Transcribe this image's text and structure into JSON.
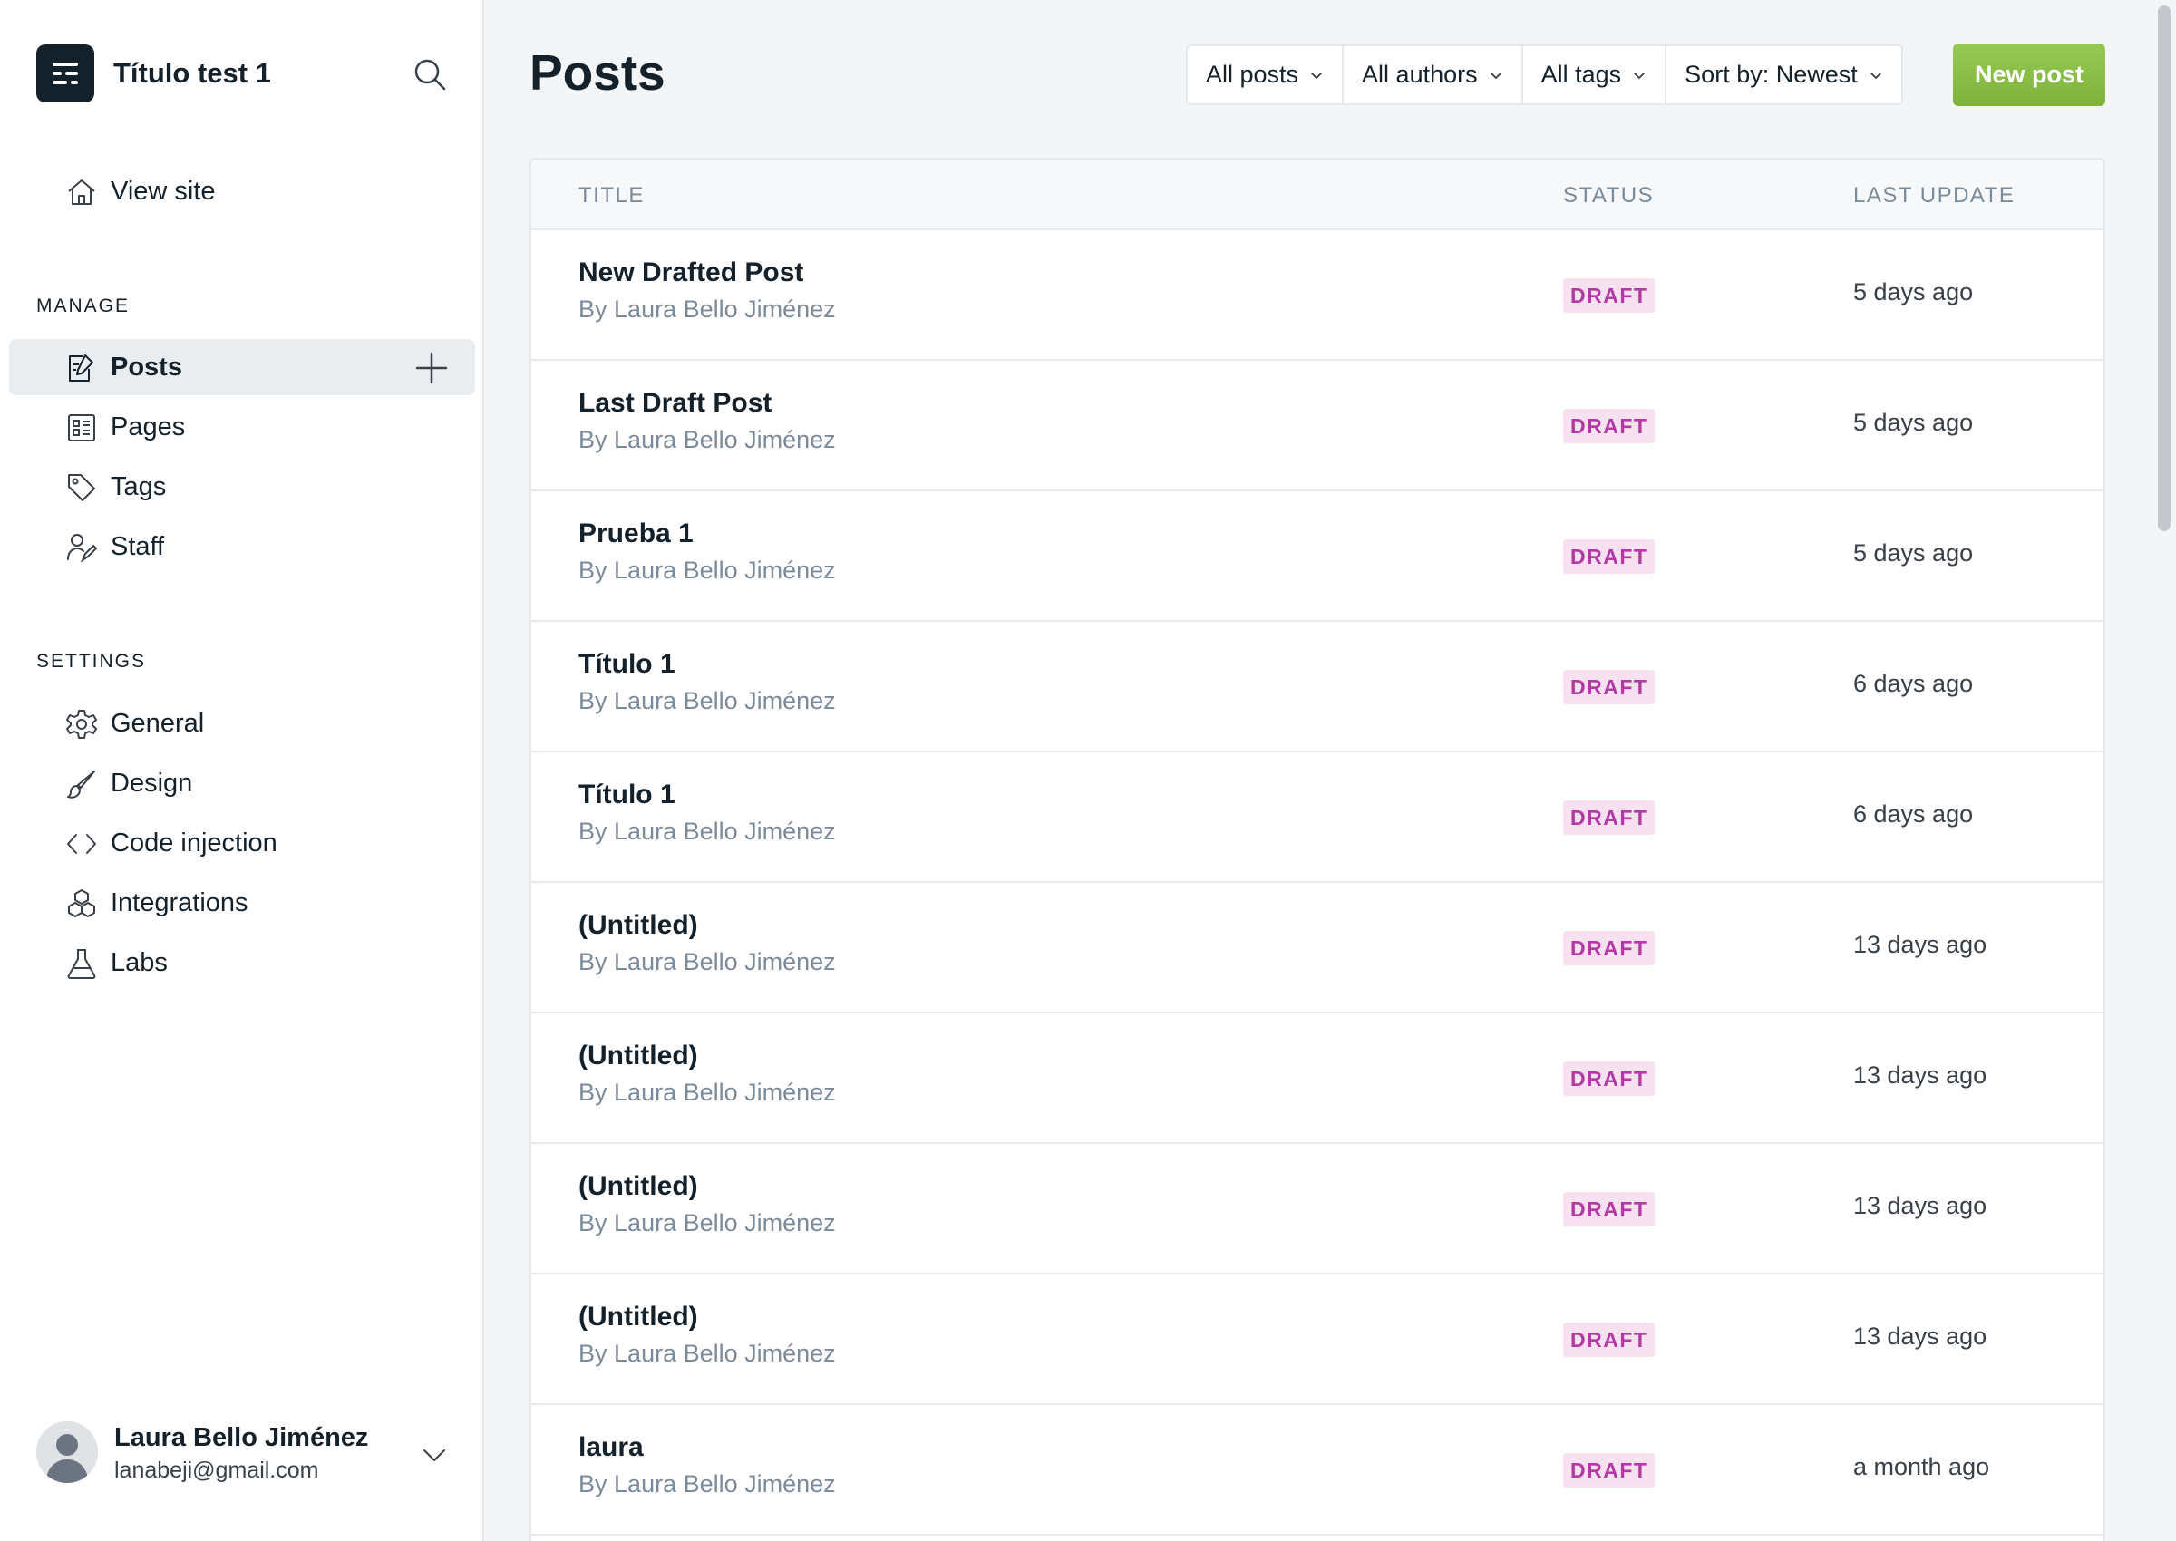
{
  "sidebar": {
    "site_title": "Título test 1",
    "view_site": "View site",
    "manage_label": "MANAGE",
    "manage_items": [
      {
        "label": "Posts",
        "icon": "posts-icon",
        "active": true
      },
      {
        "label": "Pages",
        "icon": "pages-icon"
      },
      {
        "label": "Tags",
        "icon": "tag-icon"
      },
      {
        "label": "Staff",
        "icon": "staff-icon"
      }
    ],
    "settings_label": "SETTINGS",
    "settings_items": [
      {
        "label": "General",
        "icon": "gear-icon"
      },
      {
        "label": "Design",
        "icon": "brush-icon"
      },
      {
        "label": "Code injection",
        "icon": "code-icon"
      },
      {
        "label": "Integrations",
        "icon": "integrations-icon"
      },
      {
        "label": "Labs",
        "icon": "flask-icon"
      }
    ],
    "user": {
      "name": "Laura Bello Jiménez",
      "email": "lanabeji@gmail.com"
    }
  },
  "header": {
    "title": "Posts",
    "filters": [
      "All posts",
      "All authors",
      "All tags",
      "Sort by: Newest"
    ],
    "new_post": "New post"
  },
  "table": {
    "columns": [
      "TITLE",
      "STATUS",
      "LAST UPDATE"
    ],
    "by_prefix": "By",
    "rows": [
      {
        "title": "New Drafted Post",
        "author": "Laura Bello Jiménez",
        "status": "DRAFT",
        "updated": "5 days ago"
      },
      {
        "title": "Last Draft Post",
        "author": "Laura Bello Jiménez",
        "status": "DRAFT",
        "updated": "5 days ago"
      },
      {
        "title": "Prueba 1",
        "author": "Laura Bello Jiménez",
        "status": "DRAFT",
        "updated": "5 days ago"
      },
      {
        "title": "Título 1",
        "author": "Laura Bello Jiménez",
        "status": "DRAFT",
        "updated": "6 days ago"
      },
      {
        "title": "Título 1",
        "author": "Laura Bello Jiménez",
        "status": "DRAFT",
        "updated": "6 days ago"
      },
      {
        "title": "(Untitled)",
        "author": "Laura Bello Jiménez",
        "status": "DRAFT",
        "updated": "13 days ago"
      },
      {
        "title": "(Untitled)",
        "author": "Laura Bello Jiménez",
        "status": "DRAFT",
        "updated": "13 days ago"
      },
      {
        "title": "(Untitled)",
        "author": "Laura Bello Jiménez",
        "status": "DRAFT",
        "updated": "13 days ago"
      },
      {
        "title": "(Untitled)",
        "author": "Laura Bello Jiménez",
        "status": "DRAFT",
        "updated": "13 days ago"
      },
      {
        "title": "laura",
        "author": "Laura Bello Jiménez",
        "status": "DRAFT",
        "updated": "a month ago"
      }
    ]
  },
  "colors": {
    "accent_green": "#8bc34a",
    "draft_badge_bg": "#f7e0f0",
    "draft_badge_text": "#b339a4",
    "text_dark": "#15212a",
    "text_muted": "#7c8b9a"
  }
}
